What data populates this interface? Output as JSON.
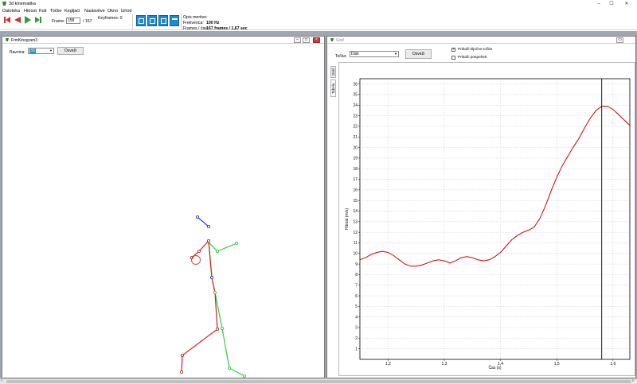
{
  "app": {
    "title": "3d kinematika",
    "colors": {
      "accent": "#1a8ad4",
      "stop": "#d32f2f",
      "play": "#2e9e34"
    }
  },
  "menu": [
    "Datoteka",
    "Hitrost",
    "Koti",
    "Točke",
    "Kegljači",
    "Nastavitve",
    "Okno",
    "Izhod"
  ],
  "toolbar": {
    "frame_label": "Frame:",
    "frame_value": "158",
    "frame_total": "/ 167",
    "keyframes": "Keyframes: 0",
    "opis_label": "Opis meritve:",
    "frekvenca_label": "Frekvenca:",
    "frekvenca_value": "100 Hz",
    "frames_label": "Frames / čas:",
    "frames_value": "167 frames / 1,67 sec",
    "icons": [
      "first-frame-icon",
      "prev-frame-icon",
      "play-icon",
      "last-frame-icon"
    ],
    "view_icons": [
      "view-3d-icon",
      "view-front-icon",
      "view-side-icon",
      "view-top-icon"
    ]
  },
  "left_window": {
    "title": "FrmKinogram3",
    "ravnina_label": "Ravnina:",
    "ravnina_value": "3D",
    "osvezi": "Osveži"
  },
  "right_window": {
    "title": "Graf",
    "tocka_label": "Točka:",
    "tocka_value": "Disk",
    "osvezi": "Osveži",
    "check1_label": "Prikaži ključne točke",
    "check1_checked": true,
    "check2_label": "Prikaži pospešek",
    "check2_checked": false,
    "tabs": [
      "Graf",
      "Tabela"
    ]
  },
  "chart_data": {
    "type": "line",
    "xlabel": "Čas (s)",
    "ylabel": "Hitrost (m/s)",
    "xlim": [
      1.15,
      1.63
    ],
    "ylim": [
      0,
      26.5
    ],
    "xticks": [
      1.2,
      1.3,
      1.4,
      1.5,
      1.6
    ],
    "xtick_labels": [
      "1,2",
      "1,3",
      "1,4",
      "1,5",
      "1,6"
    ],
    "yticks": [
      1,
      2,
      3,
      4,
      5,
      6,
      7,
      8,
      9,
      10,
      11,
      12,
      13,
      14,
      15,
      16,
      17,
      18,
      19,
      20,
      21,
      22,
      23,
      24,
      25,
      26
    ],
    "grid": true,
    "marker_x": 1.58,
    "series": [
      {
        "color": "#cc0000",
        "x": [
          1.15,
          1.16,
          1.17,
          1.18,
          1.19,
          1.2,
          1.21,
          1.22,
          1.23,
          1.24,
          1.25,
          1.26,
          1.27,
          1.28,
          1.29,
          1.3,
          1.31,
          1.32,
          1.33,
          1.34,
          1.35,
          1.36,
          1.37,
          1.38,
          1.39,
          1.4,
          1.41,
          1.42,
          1.43,
          1.44,
          1.45,
          1.46,
          1.47,
          1.48,
          1.49,
          1.5,
          1.51,
          1.52,
          1.53,
          1.54,
          1.55,
          1.56,
          1.57,
          1.58,
          1.59,
          1.6,
          1.61,
          1.62,
          1.63
        ],
        "y": [
          9.4,
          9.6,
          9.9,
          10.1,
          10.2,
          10.1,
          9.8,
          9.4,
          9.0,
          8.8,
          8.8,
          8.9,
          9.1,
          9.3,
          9.4,
          9.3,
          9.1,
          9.3,
          9.6,
          9.7,
          9.6,
          9.4,
          9.3,
          9.4,
          9.7,
          10.1,
          10.7,
          11.3,
          11.7,
          12.0,
          12.2,
          12.5,
          13.3,
          14.5,
          15.9,
          17.2,
          18.3,
          19.2,
          20.1,
          20.9,
          21.9,
          22.8,
          23.5,
          23.9,
          23.9,
          23.6,
          23.1,
          22.6,
          22.1
        ]
      }
    ]
  },
  "skeleton": {
    "segments": [
      {
        "color": "#1f3fcf",
        "points": [
          [
            248,
            273
          ],
          [
            262,
            285
          ]
        ]
      },
      {
        "color": "#2ecc40",
        "points": [
          [
            260,
            303
          ],
          [
            273,
            316
          ],
          [
            297,
            306
          ]
        ]
      },
      {
        "color": "#cc2222",
        "points": [
          [
            262,
            303
          ],
          [
            250,
            316
          ],
          [
            241,
            324
          ]
        ]
      },
      {
        "color": "#2ecc40",
        "points": [
          [
            262,
            303
          ],
          [
            266,
            349
          ],
          [
            270,
            368
          ],
          [
            279,
            413
          ],
          [
            288,
            463
          ],
          [
            307,
            473
          ]
        ]
      },
      {
        "color": "#cc2222",
        "points": [
          [
            262,
            303
          ],
          [
            266,
            349
          ],
          [
            270,
            368
          ],
          [
            273,
            414
          ],
          [
            229,
            447
          ],
          [
            228,
            468
          ]
        ]
      }
    ],
    "joints": [
      {
        "at": [
          248,
          273
        ],
        "color": "#1f3fcf"
      },
      {
        "at": [
          262,
          285
        ],
        "color": "#1f3fcf"
      },
      {
        "at": [
          273,
          316
        ],
        "color": "#2ecc40"
      },
      {
        "at": [
          297,
          306
        ],
        "color": "#2ecc40"
      },
      {
        "at": [
          250,
          316
        ],
        "color": "#cc2222"
      },
      {
        "at": [
          241,
          324
        ],
        "color": "#cc2222"
      },
      {
        "at": [
          266,
          349
        ],
        "color": "#1f3fcf"
      },
      {
        "at": [
          270,
          368
        ],
        "color": "#2ecc40"
      },
      {
        "at": [
          279,
          413
        ],
        "color": "#2ecc40"
      },
      {
        "at": [
          288,
          463
        ],
        "color": "#2ecc40"
      },
      {
        "at": [
          307,
          473
        ],
        "color": "#2ecc40"
      },
      {
        "at": [
          273,
          414
        ],
        "color": "#cc2222"
      },
      {
        "at": [
          229,
          447
        ],
        "color": "#cc2222"
      },
      {
        "at": [
          228,
          468
        ],
        "color": "#cc2222"
      },
      {
        "at": [
          262,
          303
        ],
        "color": "#cc2222"
      }
    ],
    "disk": {
      "at": [
        246,
        327
      ],
      "color": "#cc4422"
    }
  }
}
